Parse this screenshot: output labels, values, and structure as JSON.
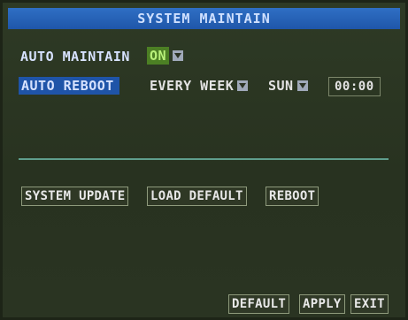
{
  "header": {
    "title": "SYSTEM MAINTAIN"
  },
  "auto_maintain": {
    "label": "AUTO MAINTAIN",
    "value": "ON"
  },
  "auto_reboot": {
    "label": "AUTO REBOOT",
    "frequency": "EVERY WEEK",
    "day": "SUN",
    "time": "00:00"
  },
  "actions": {
    "system_update": "SYSTEM UPDATE",
    "load_default": "LOAD DEFAULT",
    "reboot": "REBOOT"
  },
  "footer": {
    "default": "DEFAULT",
    "apply": "APPLY",
    "exit": "EXIT"
  },
  "colors": {
    "title_bar": "#1f56a9",
    "highlight": "#1f54a8",
    "on_badge": "#4c7f24",
    "divider": "#5f9e8d"
  }
}
